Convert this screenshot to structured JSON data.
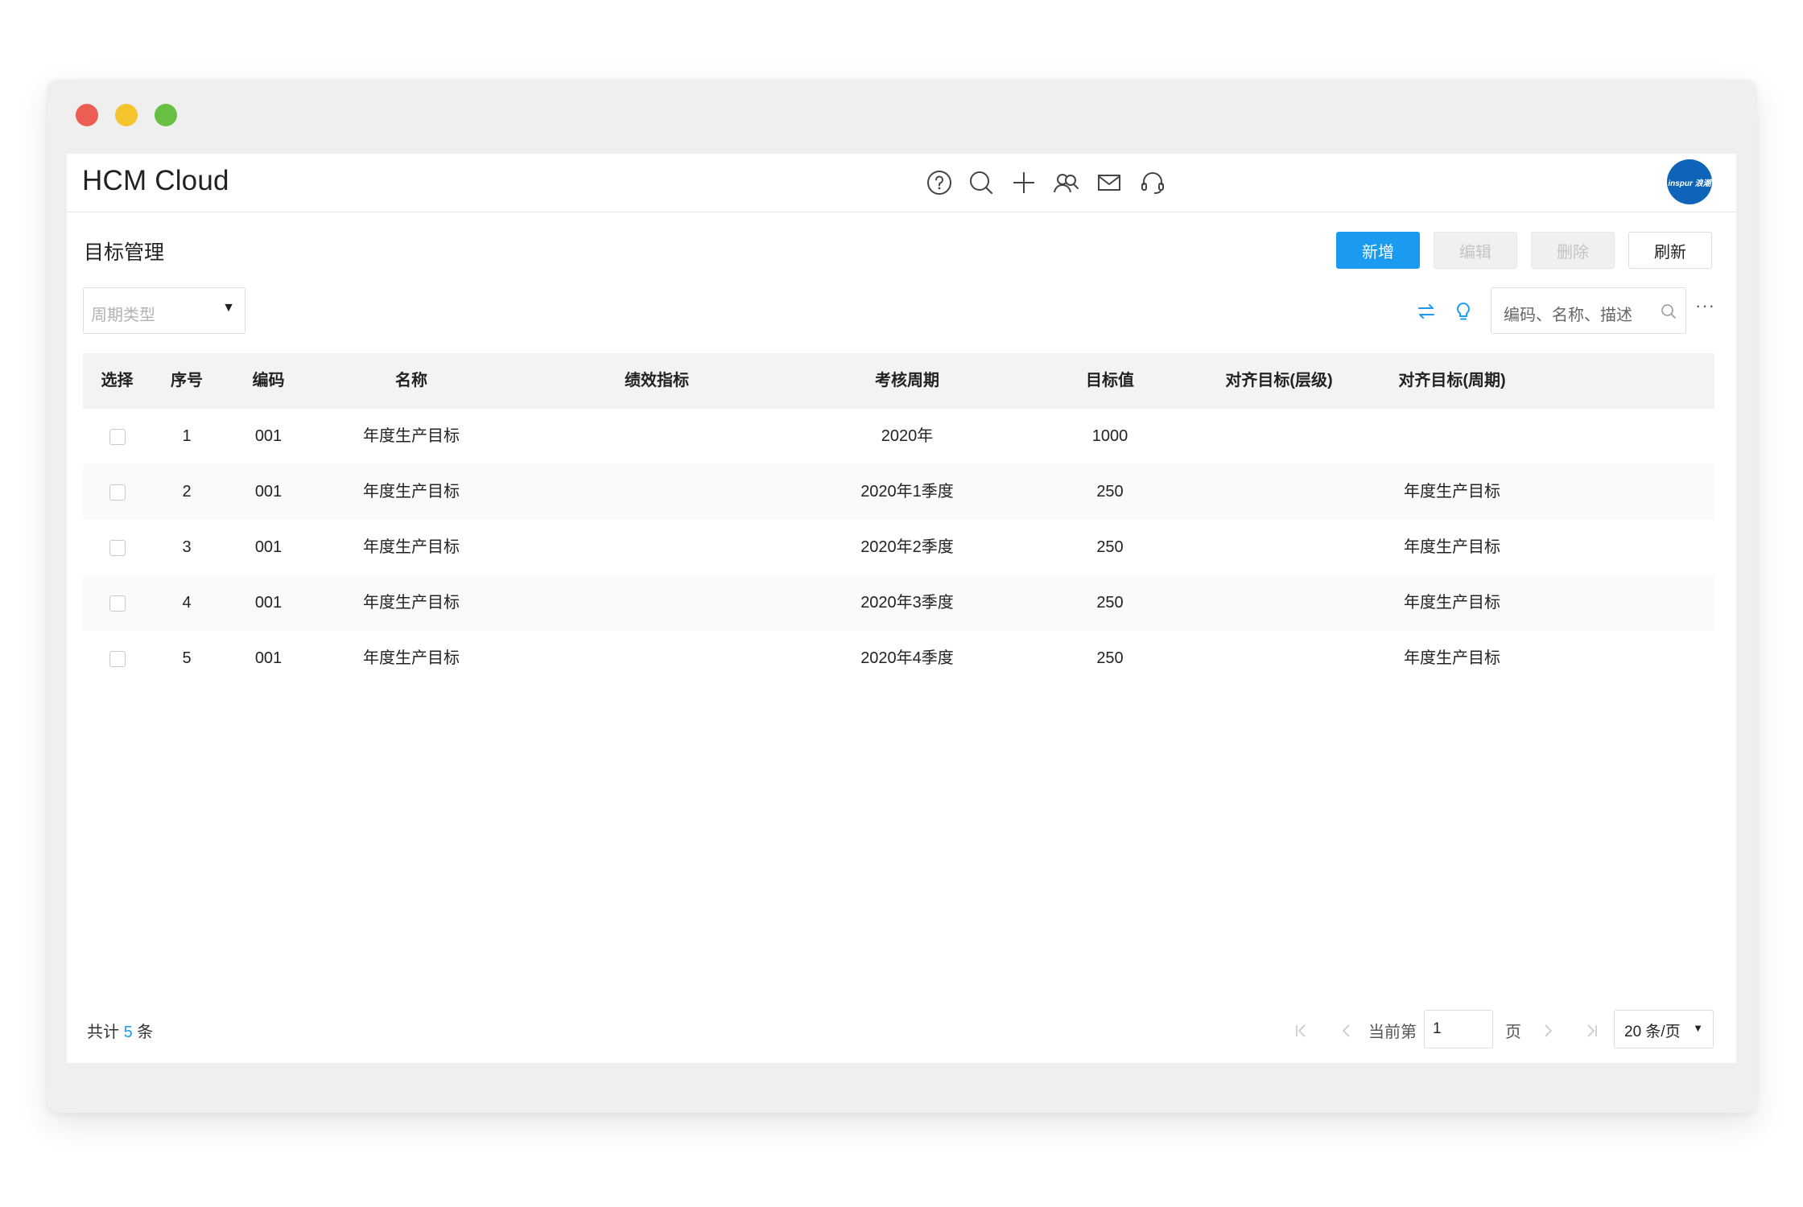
{
  "window": {
    "controls": [
      "close",
      "minimize",
      "maximize"
    ],
    "colors": {
      "close": "#ec5e54",
      "minimize": "#f4c42c",
      "maximize": "#68c042"
    }
  },
  "header": {
    "app_title": "HCM Cloud",
    "icons": [
      "help-icon",
      "search-icon",
      "add-icon",
      "contacts-icon",
      "mail-icon",
      "support-icon"
    ],
    "avatar_text": "inspur 浪潮"
  },
  "page": {
    "title": "目标管理",
    "accent_color": "#1a9bf0"
  },
  "toolbar": {
    "add_label": "新增",
    "edit_label": "编辑",
    "delete_label": "删除",
    "refresh_label": "刷新"
  },
  "filter": {
    "period_type_placeholder": "周期类型",
    "search_placeholder": "编码、名称、描述",
    "more_label": "···"
  },
  "table": {
    "columns": [
      "选择",
      "序号",
      "编码",
      "名称",
      "绩效指标",
      "考核周期",
      "目标值",
      "对齐目标(层级)",
      "对齐目标(周期)"
    ],
    "rows": [
      {
        "no": "1",
        "code": "001",
        "name": "年度生产目标",
        "kpi": "",
        "period": "2020年",
        "target": "1000",
        "align_level": "",
        "align_period": ""
      },
      {
        "no": "2",
        "code": "001",
        "name": "年度生产目标",
        "kpi": "",
        "period": "2020年1季度",
        "target": "250",
        "align_level": "",
        "align_period": "年度生产目标"
      },
      {
        "no": "3",
        "code": "001",
        "name": "年度生产目标",
        "kpi": "",
        "period": "2020年2季度",
        "target": "250",
        "align_level": "",
        "align_period": "年度生产目标"
      },
      {
        "no": "4",
        "code": "001",
        "name": "年度生产目标",
        "kpi": "",
        "period": "2020年3季度",
        "target": "250",
        "align_level": "",
        "align_period": "年度生产目标"
      },
      {
        "no": "5",
        "code": "001",
        "name": "年度生产目标",
        "kpi": "",
        "period": "2020年4季度",
        "target": "250",
        "align_level": "",
        "align_period": "年度生产目标"
      }
    ]
  },
  "pagination": {
    "total_prefix": "共计",
    "total_count": "5",
    "total_suffix": "条",
    "current_label": "当前第",
    "current_page": "1",
    "page_suffix": "页",
    "page_size": "20 条/页"
  }
}
